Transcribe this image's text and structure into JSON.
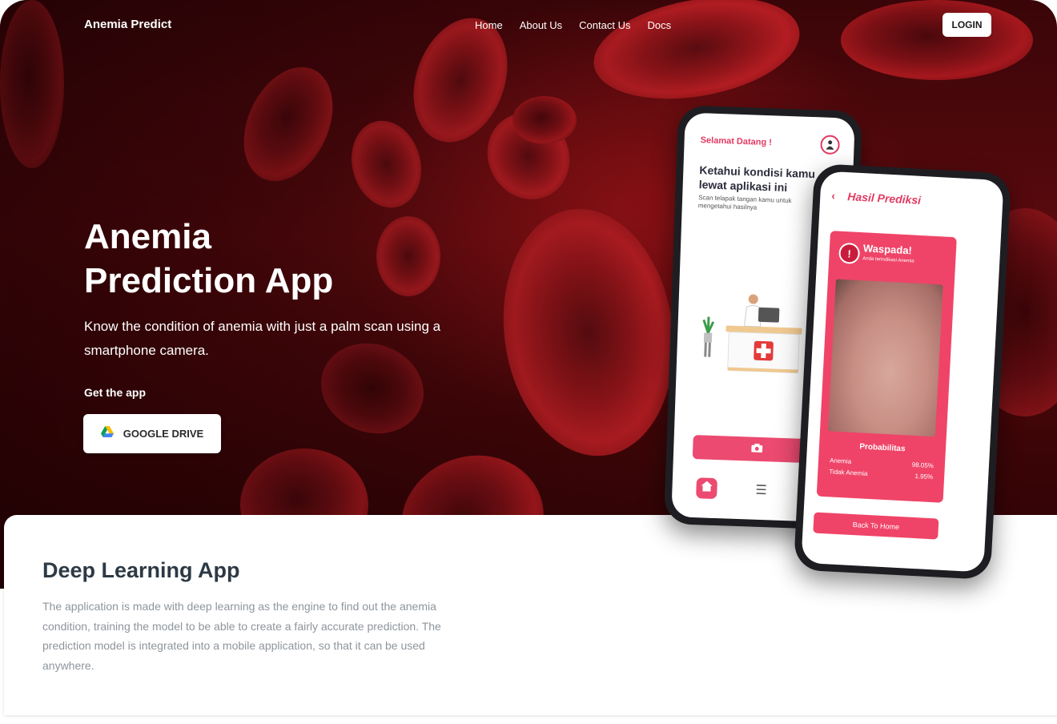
{
  "header": {
    "brand": "Anemia Predict",
    "nav": [
      "Home",
      "About Us",
      "Contact Us",
      "Docs"
    ],
    "login_label": "LOGIN"
  },
  "hero": {
    "title_line1": "Anemia",
    "title_line2": "Prediction App",
    "subtitle": "Know the condition of anemia with just a palm scan using a smartphone camera.",
    "get_app_label": "Get the app",
    "download_button": {
      "icon": "google-drive-icon",
      "label": "GOOGLE DRIVE"
    }
  },
  "phone_home": {
    "greeting": "Selamat Datang !",
    "heading": "Ketahui kondisi kamu lewat aplikasi ini",
    "description": "Scan telapak tangan kamu untuk mengetahui hasilnya",
    "icons": [
      "avatar-icon",
      "camera-icon",
      "home-icon",
      "menu-icon"
    ]
  },
  "phone_result": {
    "title": "Hasil Prediksi",
    "warning_title": "Waspada!",
    "warning_subtitle": "Anda terindikasi Anemia",
    "probability_label": "Probabilitas",
    "rows": [
      {
        "label": "Anemia",
        "value": "98.05%"
      },
      {
        "label": "Tidak Anemia",
        "value": "1.95%"
      }
    ],
    "back_home_label": "Back To Home"
  },
  "section": {
    "title": "Deep Learning App",
    "text": "The application is made with deep learning as the engine to find out the anemia condition, training the model to be able to create a fairly accurate prediction. The prediction model is integrated into a mobile application, so that it can be used anywhere."
  },
  "colors": {
    "accent": "#ec4a70",
    "hero_dark": "#3a0508",
    "heading": "#2d3a45",
    "body_text": "#8e959c"
  }
}
